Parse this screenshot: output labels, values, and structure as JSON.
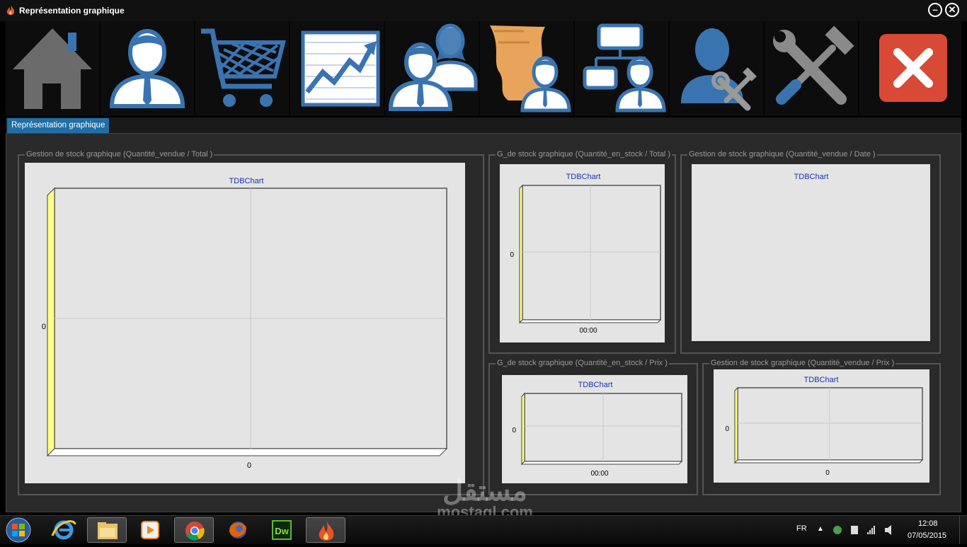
{
  "window": {
    "title": "Représentation graphique"
  },
  "toolbar": {
    "icons": [
      "home-icon",
      "client-icon",
      "shopping-cart-icon",
      "sales-chart-icon",
      "users-group-icon",
      "document-user-icon",
      "org-chart-icon",
      "user-settings-icon",
      "tools-icon",
      "close-icon"
    ]
  },
  "tab": {
    "label": "Représentation graphique"
  },
  "panels": {
    "main": {
      "legend": "Gestion de stock graphique (Quantité_vendue / Total )",
      "chart_title": "TDBChart",
      "y_label": "0",
      "x_label": "0"
    },
    "stock_total": {
      "legend": "G_de stock graphique (Quantité_en_stock / Total )",
      "chart_title": "TDBChart",
      "y_label": "0",
      "x_label": "00:00"
    },
    "vendue_date": {
      "legend": "Gestion de stock graphique (Quantité_vendue / Date )",
      "chart_title": "TDBChart"
    },
    "stock_prix": {
      "legend": "G_de stock graphique (Quantité_en_stock / Prix )",
      "chart_title": "TDBChart",
      "y_label": "0",
      "x_label": "00:00"
    },
    "vendue_prix": {
      "legend": "Gestion de stock graphique (Quantité_vendue / Prix )",
      "chart_title": "TDBChart",
      "y_label": "0",
      "x_label": "0"
    }
  },
  "taskbar": {
    "lang": "FR",
    "time": "12:08",
    "date": "07/05/2015",
    "apps": [
      "explorer-icon",
      "file-explorer-icon",
      "media-player-icon",
      "chrome-icon",
      "firefox-icon",
      "dreamweaver-icon",
      "app-flame-icon"
    ],
    "dw_label": "Dw"
  },
  "watermark": {
    "arabic": "مستقل",
    "latin": "mostaql.com"
  },
  "colors": {
    "accent": "#1f6fa6",
    "icon_blue": "#3a74b0",
    "close_red": "#d94a36",
    "chart_bg": "#e4e4e4",
    "axis_yellow": "#ffff88"
  },
  "chart_data": [
    {
      "type": "bar",
      "title": "TDBChart",
      "categories": [
        "0"
      ],
      "values": [],
      "xlabel": "",
      "ylabel": "",
      "yticks": [
        "0"
      ]
    },
    {
      "type": "bar",
      "title": "TDBChart",
      "categories": [
        "00:00"
      ],
      "values": [],
      "xlabel": "",
      "ylabel": "",
      "yticks": [
        "0"
      ]
    },
    {
      "type": "bar",
      "title": "TDBChart",
      "categories": [],
      "values": [],
      "xlabel": "",
      "ylabel": ""
    },
    {
      "type": "bar",
      "title": "TDBChart",
      "categories": [
        "00:00"
      ],
      "values": [],
      "xlabel": "",
      "ylabel": "",
      "yticks": [
        "0"
      ]
    },
    {
      "type": "bar",
      "title": "TDBChart",
      "categories": [
        "0"
      ],
      "values": [],
      "xlabel": "",
      "ylabel": "",
      "yticks": [
        "0"
      ]
    }
  ]
}
